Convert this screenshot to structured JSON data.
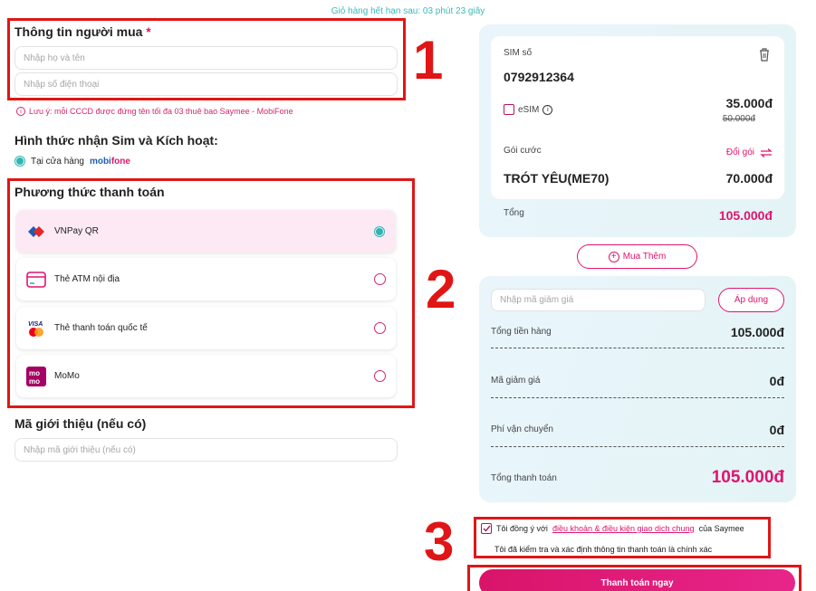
{
  "timer": "Giỏ hàng hết hạn sau: 03 phút 23 giây",
  "buyer": {
    "title": "Thông tin người mua",
    "required_mark": "*",
    "name_placeholder": "Nhập họ và tên",
    "phone_placeholder": "Nhập số điện thoại",
    "note_icon": "i",
    "note": "Lưu ý: mỗi CCCD được đứng tên tối đa 03 thuê bao Saymee - MobiFone"
  },
  "delivery": {
    "title": "Hình thức nhận Sim và Kích hoạt:",
    "option_label": "Tại cửa hàng",
    "brand_mobi": "mobi",
    "brand_fone": "fone"
  },
  "payment": {
    "title": "Phương thức thanh toán",
    "options": [
      {
        "label": "VNPay QR",
        "icon": "vnpay-icon",
        "selected": true
      },
      {
        "label": "Thẻ ATM nội địa",
        "icon": "atm-card-icon",
        "selected": false
      },
      {
        "label": "Thẻ thanh toán quốc tế",
        "icon": "visa-mastercard-icon",
        "selected": false
      },
      {
        "label": "MoMo",
        "icon": "momo-icon",
        "selected": false
      }
    ],
    "visa_text": "VISA",
    "momo_top": "mo",
    "momo_bottom": "mo"
  },
  "referral": {
    "title": "Mã giới thiệu (nếu có)",
    "placeholder": "Nhập mã giới thiệu (nếu có)"
  },
  "annotations": {
    "step1": "1",
    "step2": "2",
    "step3": "3"
  },
  "cart": {
    "sim_label": "SIM số",
    "sim_number": "0792912364",
    "esim_label": "eSIM",
    "esim_info": "i",
    "sim_price": "35.000đ",
    "sim_old_price": "50.000đ",
    "package_label": "Gói cước",
    "change_package": "Đổi gói",
    "package_name": "TRÓT YÊU(ME70)",
    "package_price": "70.000đ",
    "total_label": "Tổng",
    "total_value": "105.000đ"
  },
  "buy_more": {
    "icon": "+",
    "label": "Mua Thêm"
  },
  "summary": {
    "coupon_placeholder": "Nhập mã giảm giá",
    "apply_label": "Áp dụng",
    "rows": [
      {
        "label": "Tổng tiền hàng",
        "value": "105.000đ"
      },
      {
        "label": "Mã giảm giá",
        "value": "0đ"
      },
      {
        "label": "Phí vận chuyển",
        "value": "0đ"
      }
    ],
    "grand_total_label": "Tổng thanh toán",
    "grand_total_value": "105.000đ"
  },
  "agreement": {
    "prefix": "Tôi đồng ý với",
    "link": "điều khoản & điều kiện giao dịch chung",
    "suffix": "của Saymee",
    "confirm": "Tôi đã kiểm tra và xác định thông tin thanh toán là chính xác",
    "checked": true
  },
  "pay_button": "Thanh toán ngay",
  "colors": {
    "accent_pink": "#e0146e",
    "teal": "#2fb5b2",
    "annotation_red": "#e01616"
  }
}
